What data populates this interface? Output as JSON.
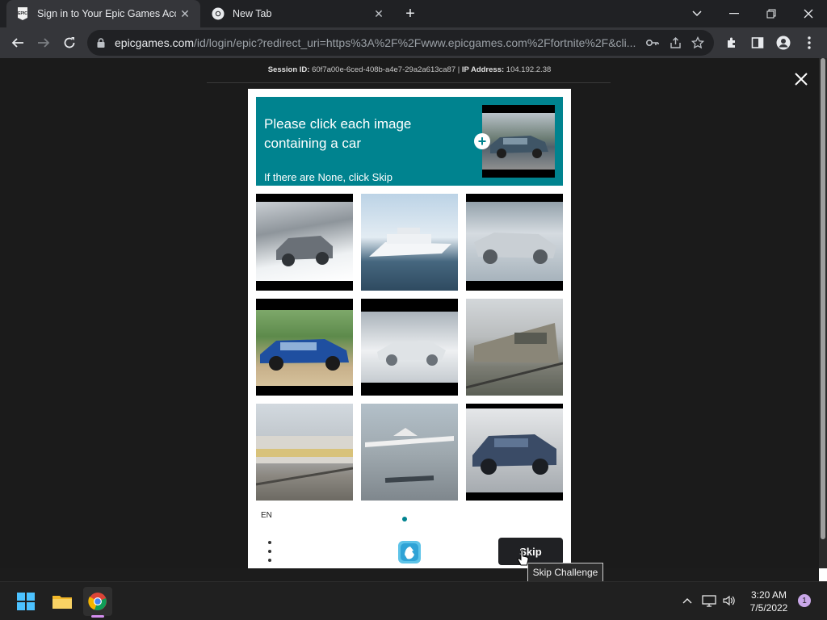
{
  "browser": {
    "tabs": [
      {
        "title": "Sign in to Your Epic Games Acco",
        "favicon": "epic-games-icon",
        "active": true
      },
      {
        "title": "New Tab",
        "favicon": "chrome-icon",
        "active": false
      }
    ],
    "url_domain": "epicgames.com",
    "url_path": "/id/login/epic?redirect_uri=https%3A%2F%2Fwww.epicgames.com%2Ffortnite%2F&cli..."
  },
  "page": {
    "session_label": "Session ID:",
    "session_id": "60f7a00e-6ced-408b-a4e7-29a2a613ca87",
    "separator": "|",
    "ip_label": "IP Address:",
    "ip_address": "104.192.2.38"
  },
  "captcha": {
    "prompt": "Please click each image containing a car",
    "subprompt": "If there are None, click Skip",
    "language": "EN",
    "skip_label": "Skip",
    "tooltip": "Skip Challenge",
    "tiles": [
      {
        "desc": "car in snow",
        "colors": [
          "#d4d8dc",
          "#8a8f94",
          "#e9ecef"
        ]
      },
      {
        "desc": "yacht",
        "colors": [
          "#cfe0ee",
          "#f4f6f8",
          "#3d5f7a"
        ]
      },
      {
        "desc": "silver car",
        "colors": [
          "#aab3ba",
          "#d7dce0",
          "#7d8f9c"
        ]
      },
      {
        "desc": "blue car",
        "colors": [
          "#6f9a5c",
          "#1f4fa0",
          "#c9b28c"
        ]
      },
      {
        "desc": "car in snow",
        "colors": [
          "#b7bfc6",
          "#eef0f2",
          "#6b7279"
        ]
      },
      {
        "desc": "train",
        "colors": [
          "#c8ccd0",
          "#8a8678",
          "#5b5f55"
        ]
      },
      {
        "desc": "train",
        "colors": [
          "#cfd6dc",
          "#d8c27a",
          "#6d6a63"
        ]
      },
      {
        "desc": "seaplane",
        "colors": [
          "#b3c0c9",
          "#eaeaea",
          "#56606a"
        ]
      },
      {
        "desc": "blue sedan",
        "colors": [
          "#d8dadc",
          "#3a4b66",
          "#9aa0a6"
        ]
      }
    ]
  },
  "taskbar": {
    "time": "3:20 AM",
    "date": "7/5/2022",
    "notifications": "1"
  }
}
